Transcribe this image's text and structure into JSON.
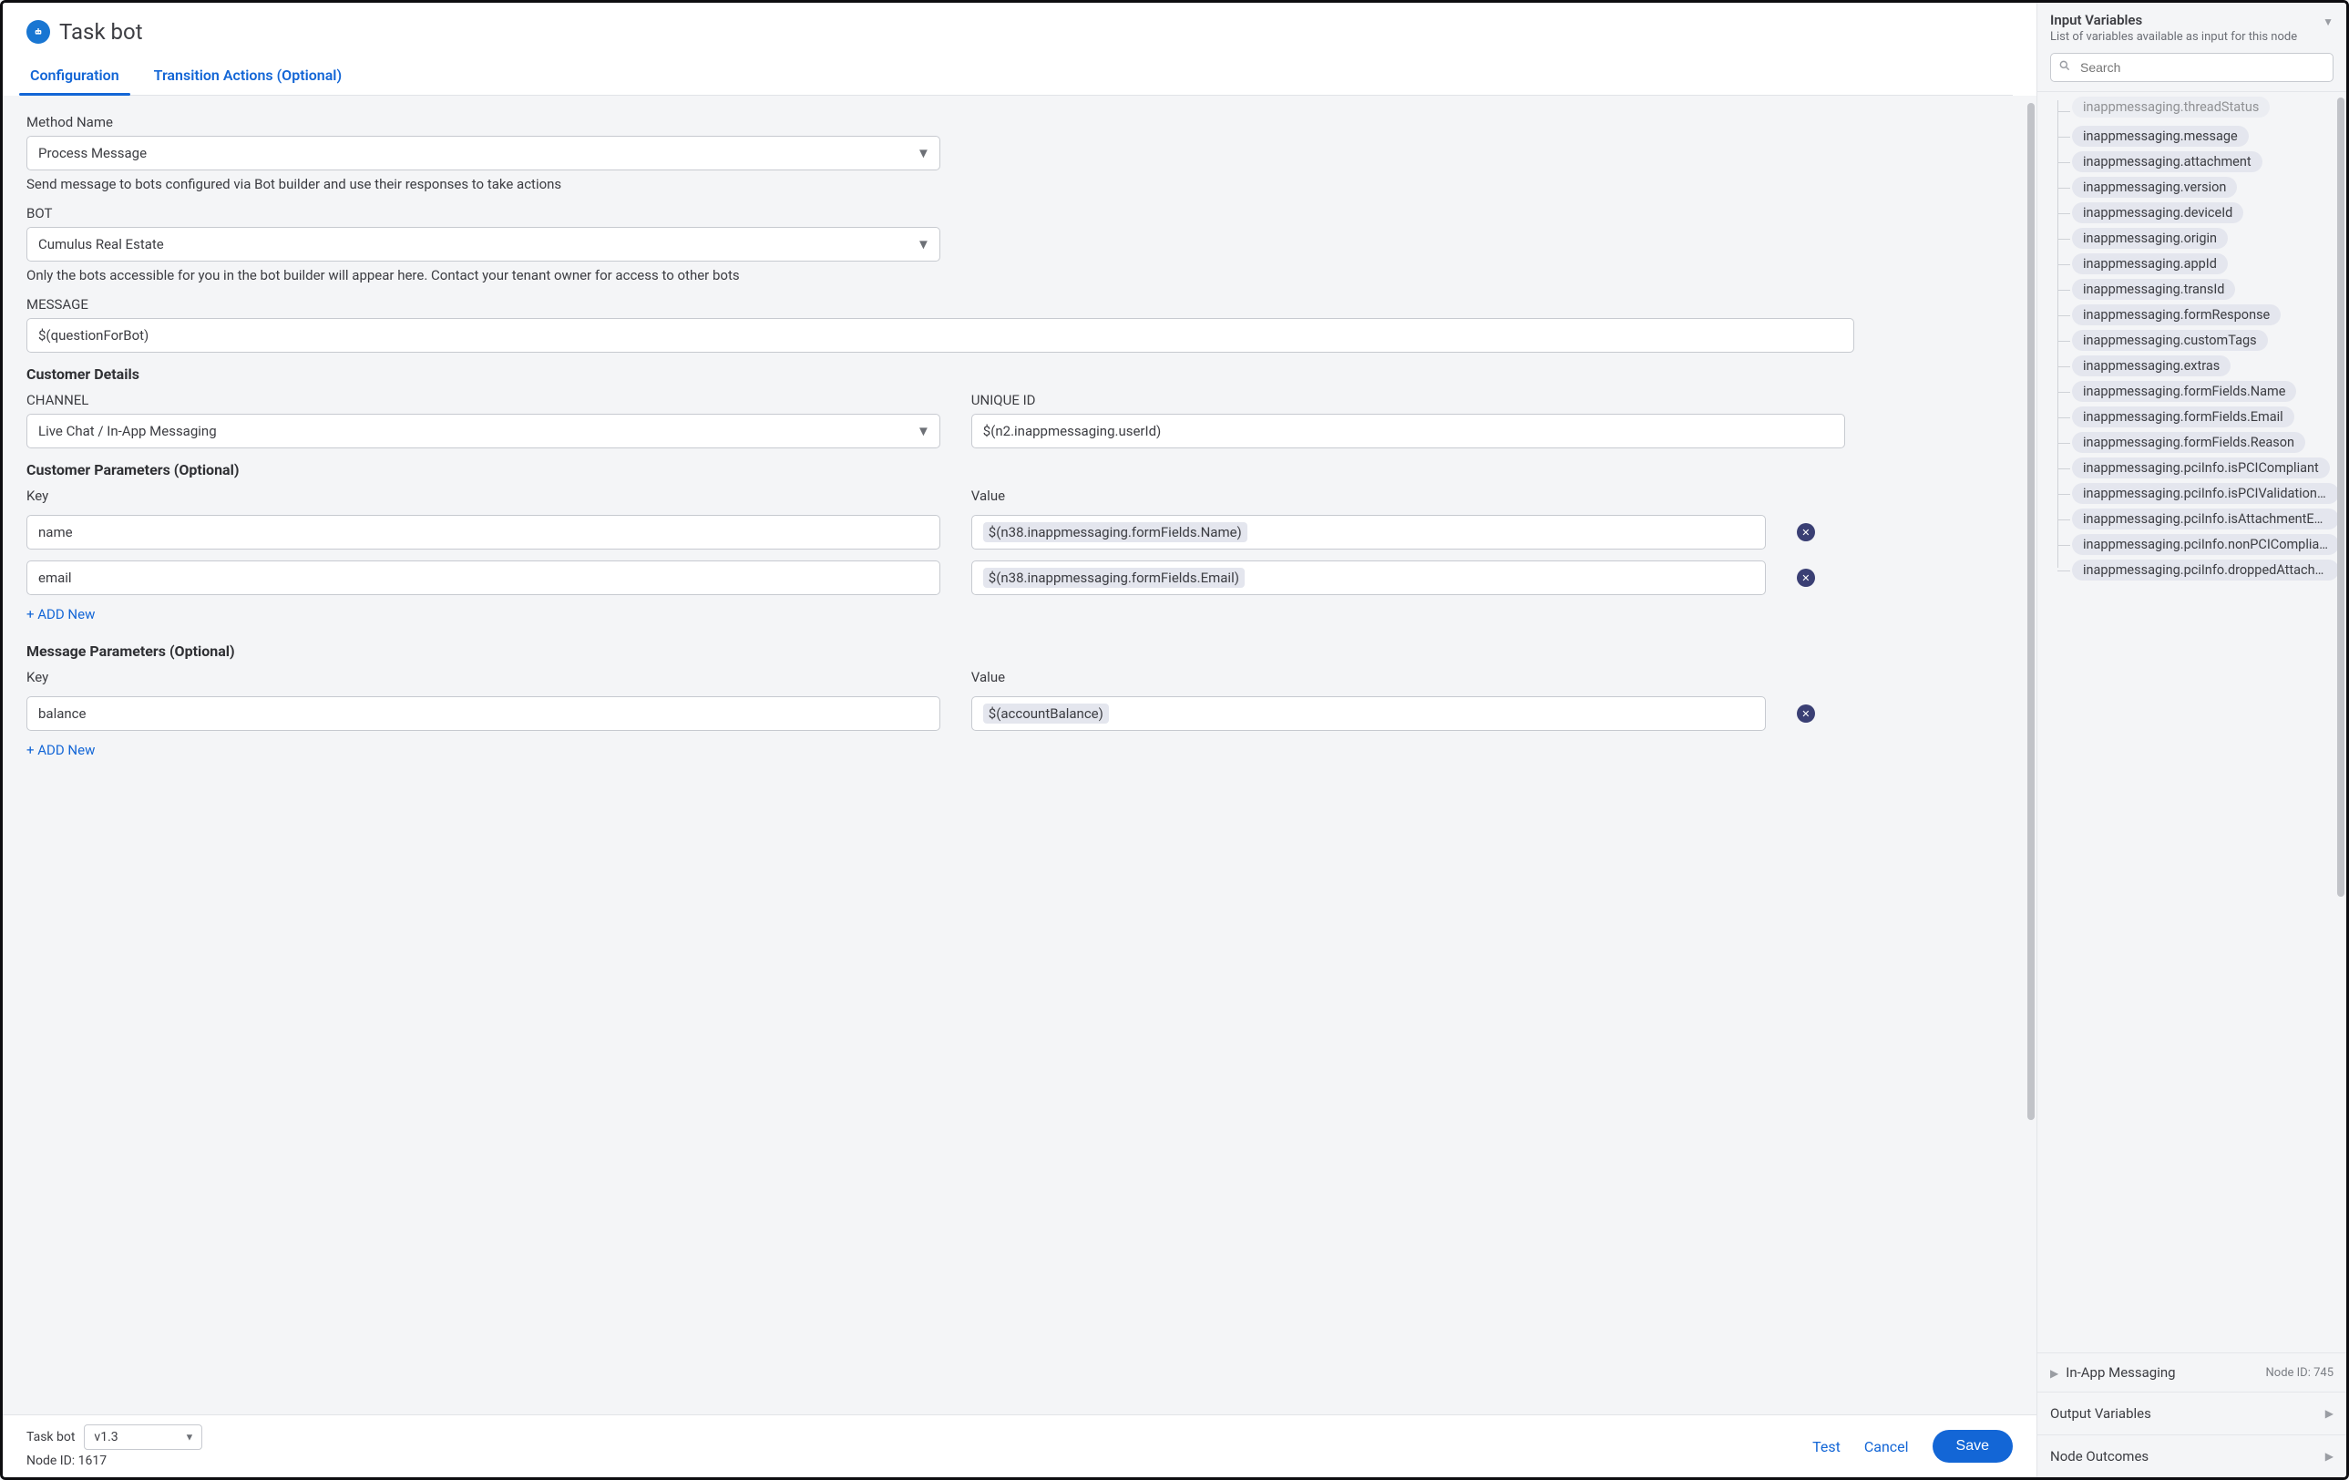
{
  "header": {
    "title": "Task bot",
    "tabs": [
      "Configuration",
      "Transition Actions (Optional)"
    ]
  },
  "method": {
    "label": "Method Name",
    "value": "Process Message",
    "help": "Send message to bots configured via Bot builder and use their responses to take actions"
  },
  "bot": {
    "label": "BOT",
    "value": "Cumulus Real Estate",
    "help": "Only the bots accessible for you in the bot builder will appear here. Contact your tenant owner for access to other bots"
  },
  "message": {
    "label": "MESSAGE",
    "value": "$(questionForBot)"
  },
  "customer_details": {
    "title": "Customer Details",
    "channel": {
      "label": "CHANNEL",
      "value": "Live Chat / In-App Messaging"
    },
    "unique": {
      "label": "UNIQUE ID",
      "value": "$(n2.inappmessaging.userId)"
    }
  },
  "customer_params": {
    "title": "Customer Parameters (Optional)",
    "key_label": "Key",
    "value_label": "Value",
    "rows": [
      {
        "key": "name",
        "value": "$(n38.inappmessaging.formFields.Name)"
      },
      {
        "key": "email",
        "value": "$(n38.inappmessaging.formFields.Email)"
      }
    ],
    "add": "+ ADD New"
  },
  "message_params": {
    "title": "Message Parameters (Optional)",
    "key_label": "Key",
    "value_label": "Value",
    "rows": [
      {
        "key": "balance",
        "value": "$(accountBalance)"
      }
    ],
    "add": "+ ADD New"
  },
  "footer": {
    "name": "Task bot",
    "version": "v1.3",
    "node_id": "Node ID: 1617",
    "test": "Test",
    "cancel": "Cancel",
    "save": "Save"
  },
  "sidebar": {
    "input_vars": {
      "title": "Input Variables",
      "subtitle": "List of variables available as input for this node",
      "search_placeholder": "Search",
      "items": [
        "inappmessaging.threadStatus",
        "inappmessaging.message",
        "inappmessaging.attachment",
        "inappmessaging.version",
        "inappmessaging.deviceId",
        "inappmessaging.origin",
        "inappmessaging.appId",
        "inappmessaging.transId",
        "inappmessaging.formResponse",
        "inappmessaging.customTags",
        "inappmessaging.extras",
        "inappmessaging.formFields.Name",
        "inappmessaging.formFields.Email",
        "inappmessaging.formFields.Reason",
        "inappmessaging.pciInfo.isPCICompliant",
        "inappmessaging.pciInfo.isPCIValidationEnabled",
        "inappmessaging.pciInfo.isAttachmentEnabled",
        "inappmessaging.pciInfo.nonPCICompliant",
        "inappmessaging.pciInfo.droppedAttachments"
      ]
    },
    "inapp": {
      "label": "In-App Messaging",
      "node": "Node ID: 745"
    },
    "output": "Output Variables",
    "outcomes": "Node Outcomes"
  }
}
